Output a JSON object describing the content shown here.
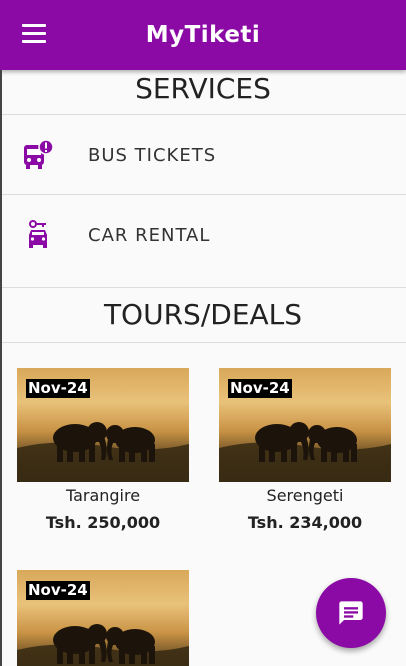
{
  "app_bar": {
    "title": "MyTiketi",
    "menu_icon": "hamburger-menu-icon",
    "color": "#8b0aa5"
  },
  "services": {
    "heading": "SERVICES",
    "items": [
      {
        "label": "BUS TICKETS",
        "icon": "bus-alert-icon"
      },
      {
        "label": "CAR RENTAL",
        "icon": "car-rental-icon"
      }
    ]
  },
  "tours": {
    "heading": "TOURS/DEALS",
    "deals": [
      {
        "date": "Nov-24",
        "name": "Tarangire",
        "price": "Tsh. 250,000"
      },
      {
        "date": "Nov-24",
        "name": "Serengeti",
        "price": "Tsh. 234,000"
      },
      {
        "date": "Nov-24",
        "name": "",
        "price": ""
      }
    ]
  },
  "fab": {
    "icon": "message-icon"
  }
}
